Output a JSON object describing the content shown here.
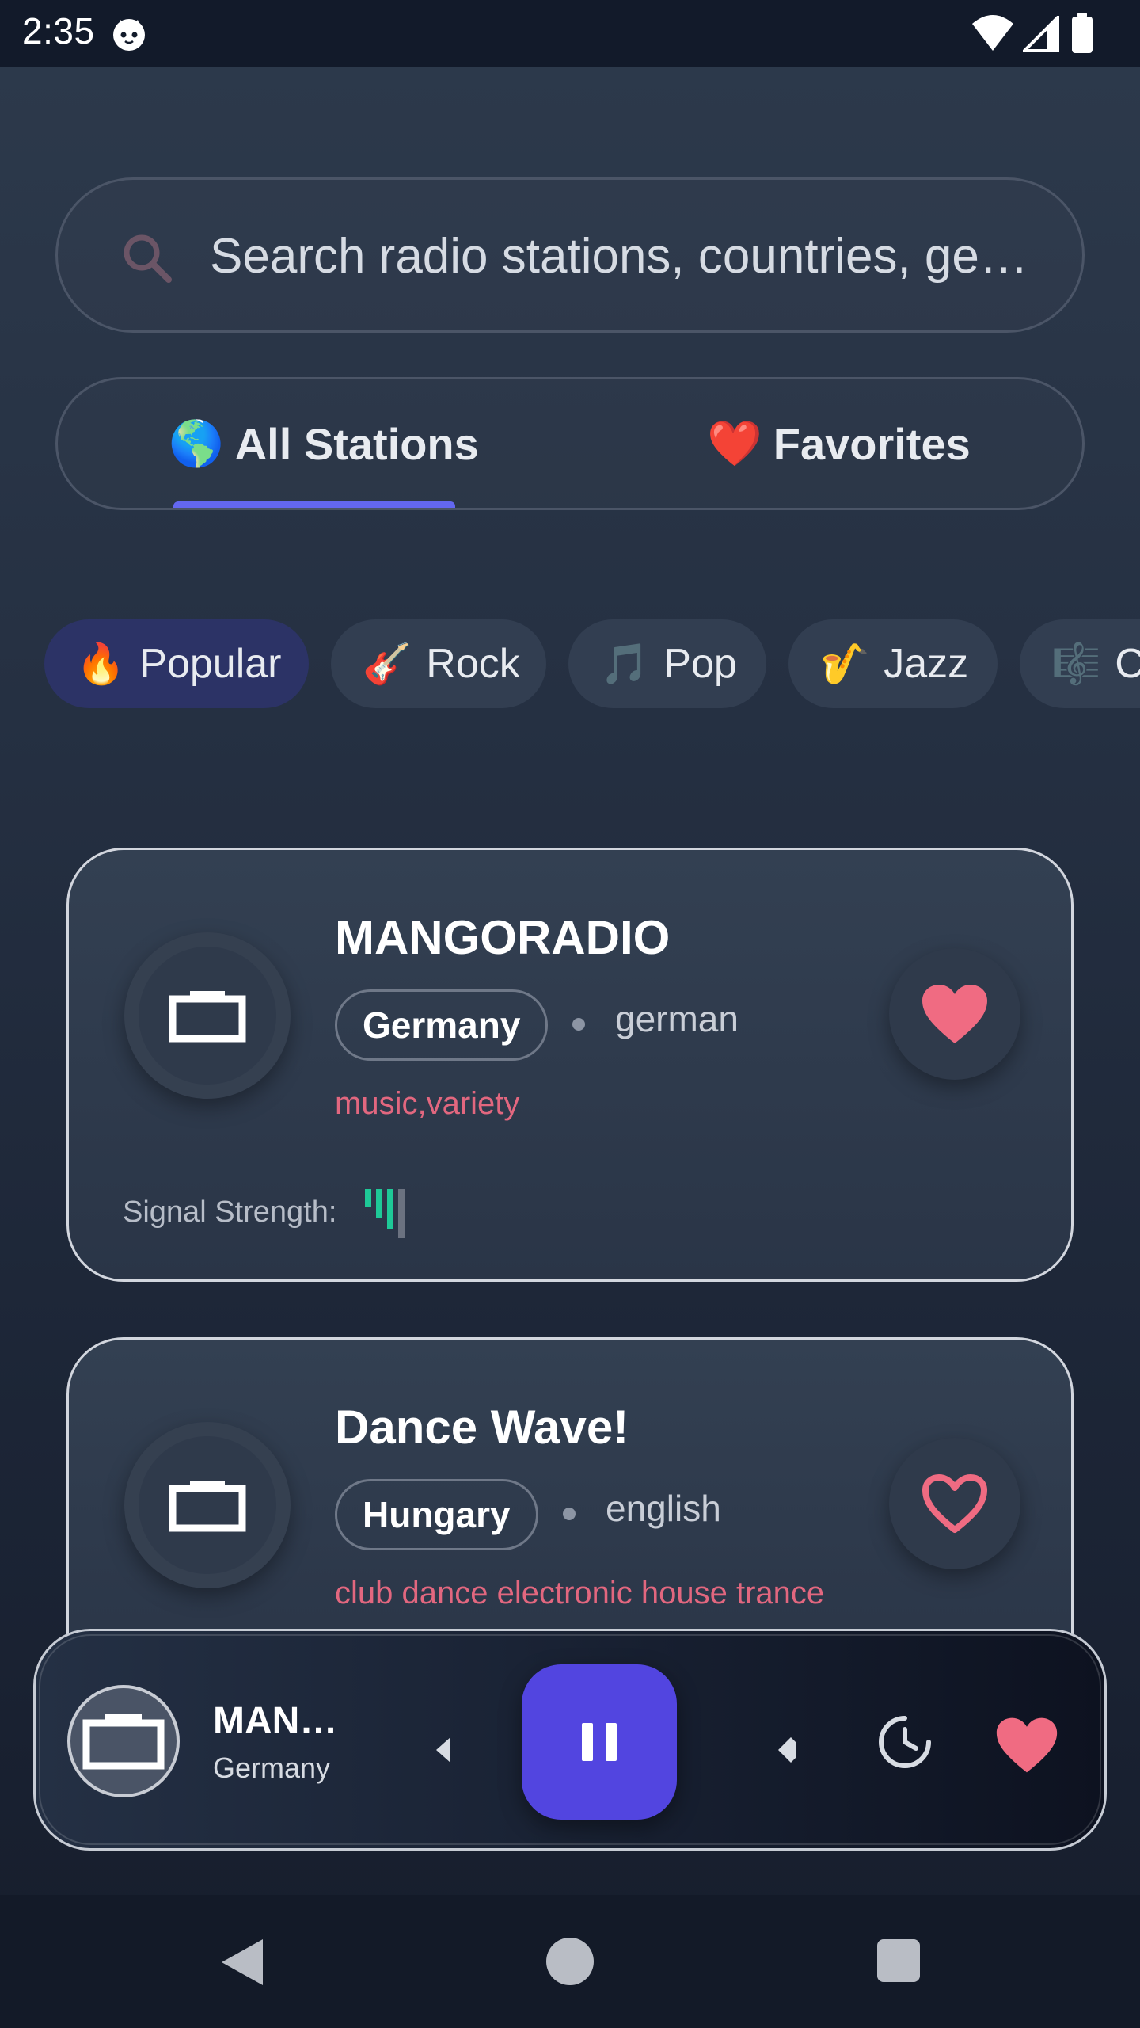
{
  "status_bar": {
    "time": "2:35",
    "icons": [
      "cat-notification-icon",
      "wifi-icon",
      "cell-signal-icon",
      "battery-icon"
    ]
  },
  "search": {
    "placeholder": "Search radio stations, countries, ge…",
    "icon": "search-icon"
  },
  "tabs": [
    {
      "emoji": "🌎",
      "label": "All Stations",
      "active": true
    },
    {
      "emoji": "❤️",
      "label": "Favorites",
      "active": false
    }
  ],
  "chips": [
    {
      "emoji": "🔥",
      "label": "Popular",
      "active": true
    },
    {
      "emoji": "🎸",
      "label": "Rock",
      "active": false
    },
    {
      "emoji": "🎵",
      "label": "Pop",
      "active": false
    },
    {
      "emoji": "🎷",
      "label": "Jazz",
      "active": false
    },
    {
      "emoji": "🎼",
      "label": "C",
      "active": false
    }
  ],
  "stations": [
    {
      "name": "MANGORADIO",
      "country": "Germany",
      "language": "german",
      "tags": "music,variety",
      "favorite": true,
      "signal_label": "Signal Strength:",
      "signal_level": 3,
      "signal_max": 4
    },
    {
      "name": "Dance Wave!",
      "country": "Hungary",
      "language": "english",
      "tags": "club dance electronic house trance",
      "favorite": false
    }
  ],
  "player": {
    "title": "MAN…",
    "subtitle": "Germany",
    "state": "playing",
    "favorite": true
  },
  "colors": {
    "accent": "#5245e0",
    "tab_indicator": "#6367f0",
    "tags": "#e2677f",
    "heart": "#f06b82",
    "signal_on": "#1ec997",
    "signal_off": "#6b7280"
  }
}
